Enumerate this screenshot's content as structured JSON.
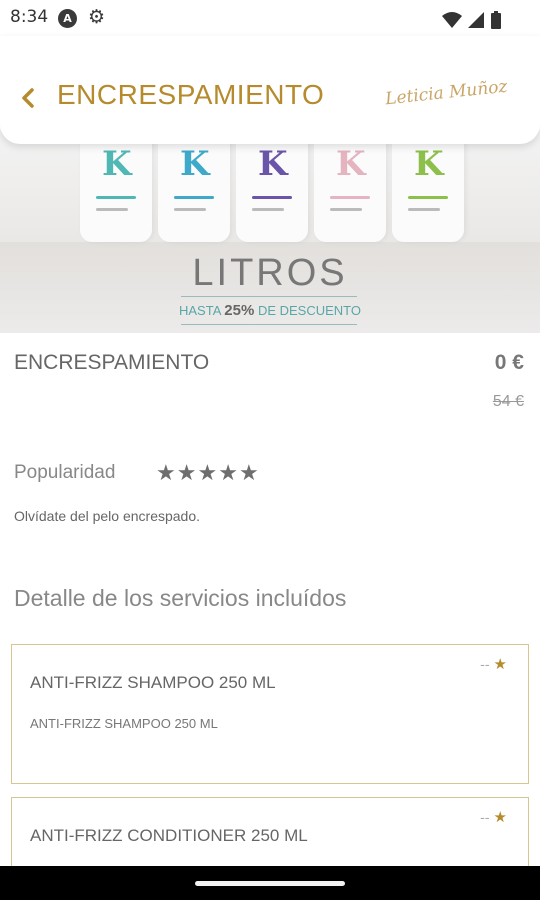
{
  "status_bar": {
    "time": "8:34",
    "icons": [
      "a-notification-icon",
      "gear-icon",
      "wifi-icon",
      "signal-icon",
      "battery-icon"
    ]
  },
  "header": {
    "title": "ENCRESPAMIENTO",
    "brand": "Leticia Muñoz",
    "accent_color": "#b58b2d"
  },
  "hero": {
    "title": "LITROS",
    "promo_prefix": "HASTA",
    "promo_value": "25%",
    "promo_suffix": "DE DESCUENTO"
  },
  "product": {
    "name": "ENCRESPAMIENTO",
    "price": "0 €",
    "old_price": "54 €",
    "popularity_label": "Popularidad",
    "rating": 5,
    "description": "Olvídate del pelo encrespado."
  },
  "services": {
    "heading": "Detalle de los servicios incluídos",
    "items": [
      {
        "title": "ANTI-FRIZZ SHAMPOO 250 ML",
        "subtitle": "ANTI-FRIZZ SHAMPOO 250 ML",
        "rating": "--"
      },
      {
        "title": "ANTI-FRIZZ CONDITIONER 250 ML",
        "rating": "--"
      }
    ]
  }
}
